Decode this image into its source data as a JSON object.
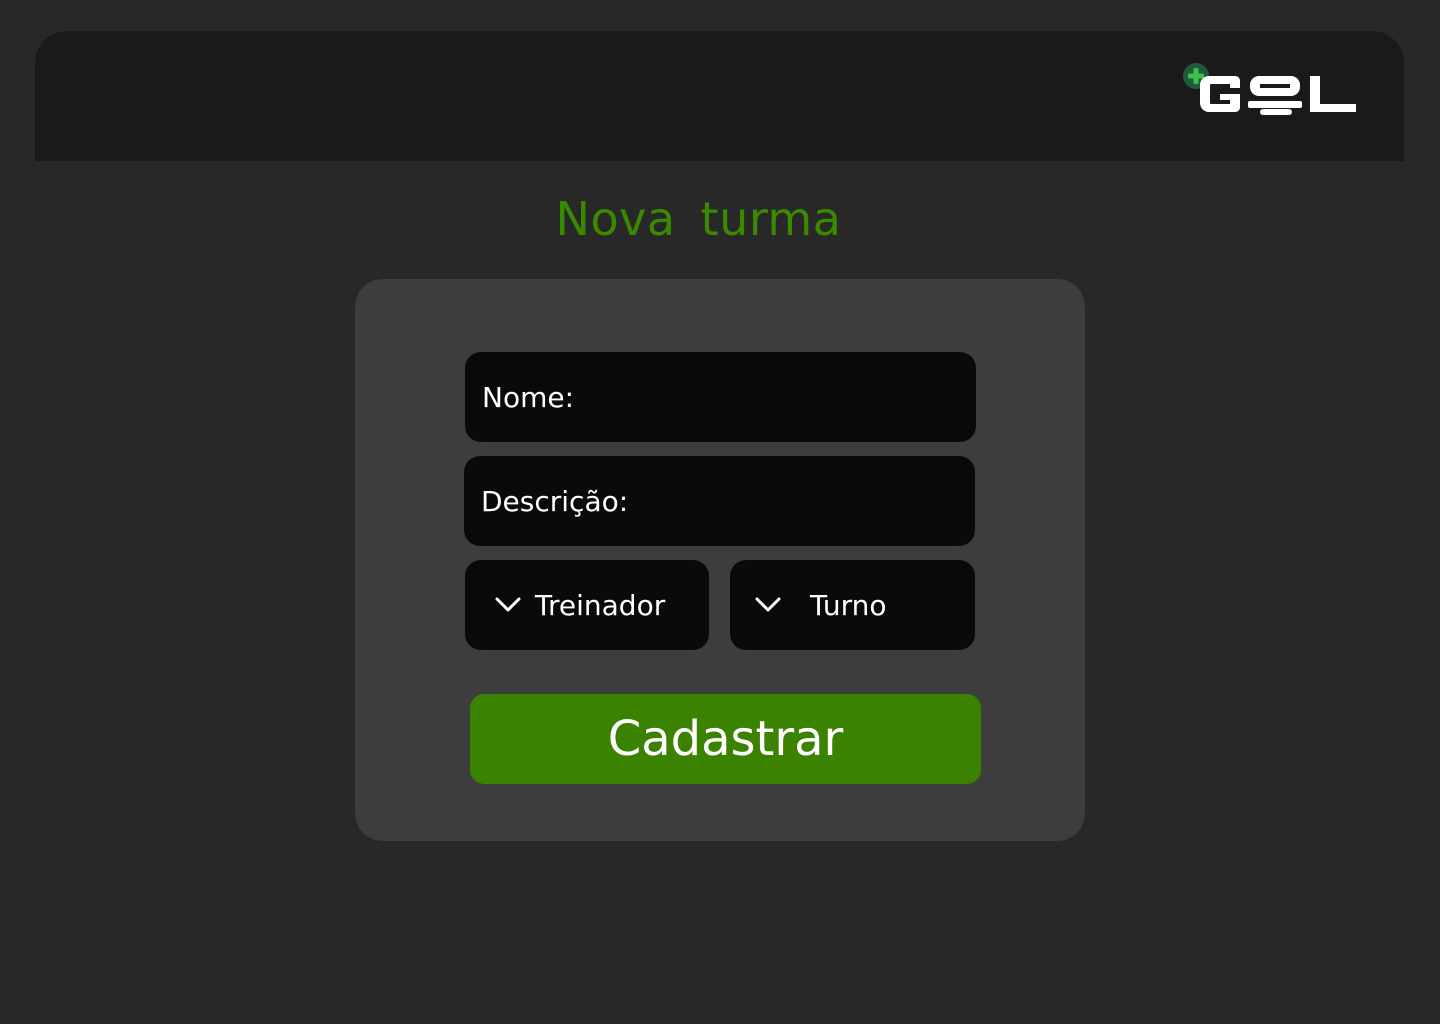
{
  "header": {
    "logo_text": "+GOL",
    "logo_icon": "plus-icon",
    "accent_color": "#3a8a00"
  },
  "main": {
    "title": "Nova turma"
  },
  "form": {
    "name_placeholder": "Nome:",
    "description_placeholder": "Descrição:",
    "trainer_select": {
      "label": "Treinador",
      "icon": "chevron-down-icon"
    },
    "shift_select": {
      "label": "Turno",
      "icon": "chevron-down-icon"
    },
    "submit_label": "Cadastrar",
    "submit_color": "#3a8200"
  }
}
